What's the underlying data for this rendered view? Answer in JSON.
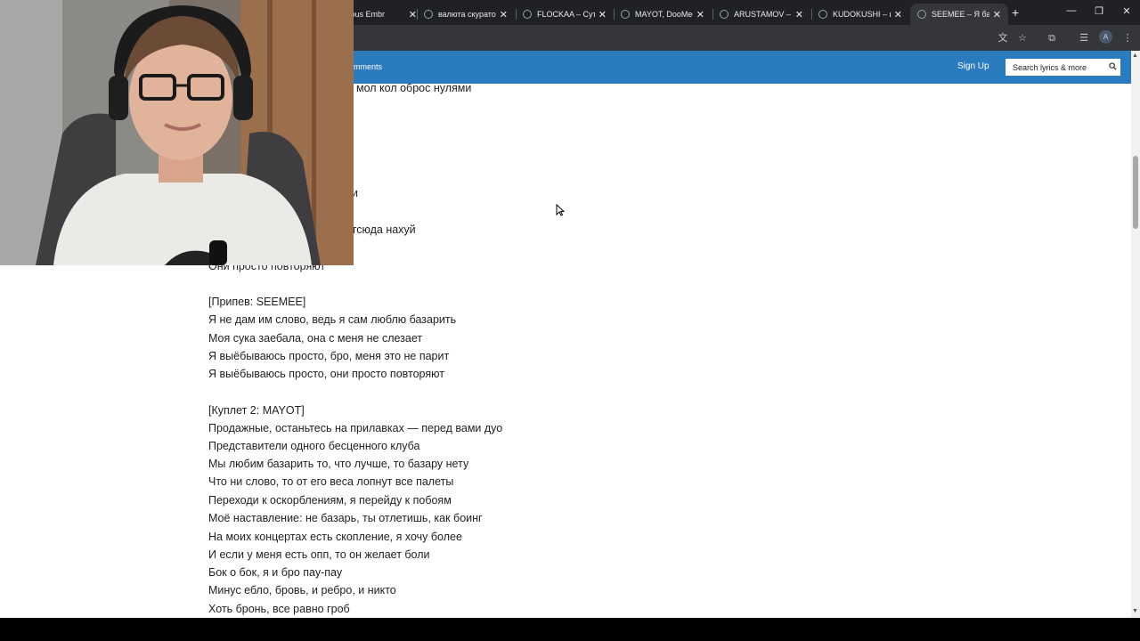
{
  "tabs": [
    {
      "title": "...ymous Embr"
    },
    {
      "title": "валюта скуратов"
    },
    {
      "title": "FLOCKAA – Сутки"
    },
    {
      "title": "MAYOT, DooMee,"
    },
    {
      "title": "ARUSTAMOV – кт"
    },
    {
      "title": "KUDOKUSHI – не"
    },
    {
      "title": "SEEMEE – Я базар"
    }
  ],
  "toolbar": {
    "translate_icon": "translate-icon",
    "bookmark_icon": "star-icon",
    "extensions_icon": "puzzle-icon",
    "media_icon": "media-queue-icon",
    "profile_initial": "A",
    "menu_icon": "kebab-icon"
  },
  "site": {
    "nav_comments": "mments",
    "signup": "Sign Up",
    "search_placeholder": "Search lyrics & more"
  },
  "lyrics": [
    "мол кол оброс нулями",
    "и",
    "отсюда нахуй",
    "Они просто повторяют",
    "",
    "[Припев: SEEMEE]",
    "Я не дам им слово, ведь я сам люблю базарить",
    "Моя сука заебала, она с меня не слезает",
    "Я выёбываюсь просто, бро, меня это не парит",
    "Я выёбываюсь просто, они просто повторяют",
    "",
    "[Куплет 2: MAYOT]",
    "Продажные, останьтесь на прилавках — перед вами дуо",
    "Представители одного бесценного клуба",
    "Мы любим базарить то, что лучше, то базару нету",
    "Что ни слово, то от его веса лопнут все палеты",
    "Переходи к оскорблениям, я перейду к побоям",
    "Моё наставление: не базарь, ты отлетишь, как боинг",
    "На моих концертах есть скопление, я хочу более",
    "И если у меня есть опп, то он желает боли",
    "Бок о бок, я и бро пау-пау",
    "Минус ебло, бровь, и ребро, и никто",
    "Хоть бронь, все равно гроб"
  ]
}
